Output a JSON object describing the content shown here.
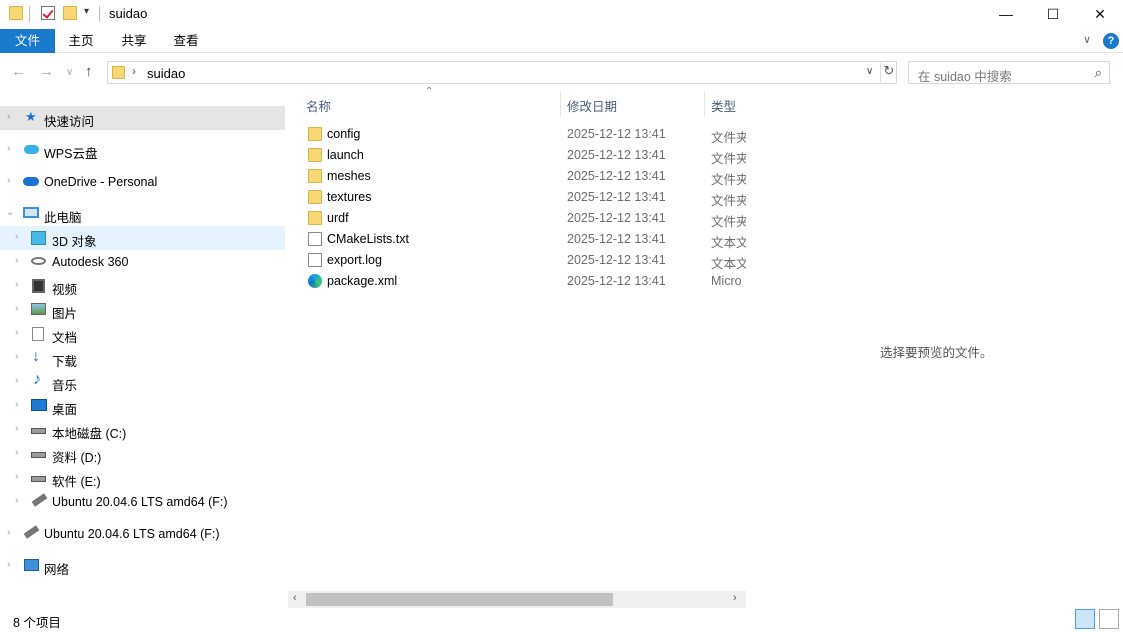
{
  "window": {
    "title": "suidao",
    "minimize": "—",
    "maximize": "☐",
    "close": "✕"
  },
  "ribbon": {
    "tabs": [
      "文件",
      "主页",
      "共享",
      "查看"
    ]
  },
  "address": {
    "path": "suidao",
    "search_placeholder": "在 suidao 中搜索"
  },
  "sidebar": {
    "items": [
      {
        "label": "快速访问",
        "icon": "star-icon"
      },
      {
        "label": "WPS云盘",
        "icon": "cloud-icon"
      },
      {
        "label": "OneDrive - Personal",
        "icon": "onedrive-icon"
      },
      {
        "label": "此电脑",
        "icon": "computer-icon"
      },
      {
        "label": "3D 对象",
        "icon": "cube-icon"
      },
      {
        "label": "Autodesk 360",
        "icon": "autodesk-icon"
      },
      {
        "label": "视频",
        "icon": "video-icon"
      },
      {
        "label": "图片",
        "icon": "picture-icon"
      },
      {
        "label": "文档",
        "icon": "document-icon"
      },
      {
        "label": "下载",
        "icon": "download-icon"
      },
      {
        "label": "音乐",
        "icon": "music-icon"
      },
      {
        "label": "桌面",
        "icon": "desktop-icon"
      },
      {
        "label": "本地磁盘 (C:)",
        "icon": "drive-c-icon"
      },
      {
        "label": "资料 (D:)",
        "icon": "drive-icon"
      },
      {
        "label": "软件 (E:)",
        "icon": "drive-icon"
      },
      {
        "label": "Ubuntu 20.04.6 LTS amd64 (F:)",
        "icon": "usb-drive-icon"
      },
      {
        "label": "Ubuntu 20.04.6 LTS amd64 (F:)",
        "icon": "usb-drive-icon"
      },
      {
        "label": "网络",
        "icon": "network-icon"
      }
    ]
  },
  "columns": {
    "name": "名称",
    "date": "修改日期",
    "type": "类型"
  },
  "files": [
    {
      "name": "config",
      "date": "2025-12-12 13:41",
      "type": "文件夹",
      "icon": "folder-icon"
    },
    {
      "name": "launch",
      "date": "2025-12-12 13:41",
      "type": "文件夹",
      "icon": "folder-icon"
    },
    {
      "name": "meshes",
      "date": "2025-12-12 13:41",
      "type": "文件夹",
      "icon": "folder-icon"
    },
    {
      "name": "textures",
      "date": "2025-12-12 13:41",
      "type": "文件夹",
      "icon": "folder-icon"
    },
    {
      "name": "urdf",
      "date": "2025-12-12 13:41",
      "type": "文件夹",
      "icon": "folder-icon"
    },
    {
      "name": "CMakeLists.txt",
      "date": "2025-12-12 13:41",
      "type": "文本文",
      "icon": "text-file-icon"
    },
    {
      "name": "export.log",
      "date": "2025-12-12 13:41",
      "type": "文本文",
      "icon": "text-file-icon"
    },
    {
      "name": "package.xml",
      "date": "2025-12-12 13:41",
      "type": "Micro",
      "icon": "edge-icon"
    }
  ],
  "preview": {
    "message": "选择要预览的文件。"
  },
  "status": {
    "item_count": "8 个项目"
  }
}
